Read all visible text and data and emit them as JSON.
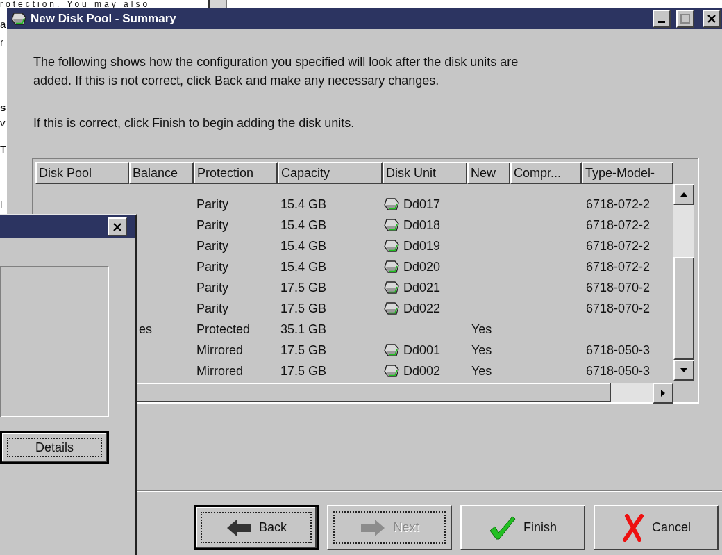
{
  "background_page": {
    "top_line": "rotection. You may also",
    "fragments": [
      {
        "text": "a",
        "bold": false
      },
      {
        "text": "r",
        "bold": false
      },
      {
        "text": "s",
        "bold": true
      },
      {
        "text": "v",
        "bold": false
      },
      {
        "text": "T",
        "bold": false
      },
      {
        "text": "l",
        "bold": false
      }
    ]
  },
  "window": {
    "title": "New Disk Pool - Summary"
  },
  "intro_lines": [
    "The following shows how the configuration you specified will look after the disk units are",
    "added.  If this is not correct, click Back and make any necessary changes."
  ],
  "instruction": "If this is correct, click Finish to begin adding the disk units.",
  "table": {
    "columns": [
      "Disk Pool",
      "Balance",
      "Protection",
      "Capacity",
      "Disk Unit",
      "New",
      "Compr...",
      "Type-Model-"
    ],
    "rows": [
      {
        "protection": "Parity",
        "capacity": "15.4 GB",
        "disk_unit": "Dd017",
        "type_model": "6718-072-2"
      },
      {
        "protection": "Parity",
        "capacity": "15.4 GB",
        "disk_unit": "Dd018",
        "type_model": "6718-072-2"
      },
      {
        "protection": "Parity",
        "capacity": "15.4 GB",
        "disk_unit": "Dd019",
        "type_model": "6718-072-2"
      },
      {
        "protection": "Parity",
        "capacity": "15.4 GB",
        "disk_unit": "Dd020",
        "type_model": "6718-072-2"
      },
      {
        "protection": "Parity",
        "capacity": "17.5 GB",
        "disk_unit": "Dd021",
        "type_model": "6718-070-2"
      },
      {
        "protection": "Parity",
        "capacity": "17.5 GB",
        "disk_unit": "Dd022",
        "type_model": "6718-070-2"
      },
      {
        "balance": "es",
        "protection": "Protected",
        "capacity": "35.1 GB",
        "new": "Yes"
      },
      {
        "protection": "Mirrored",
        "capacity": "17.5 GB",
        "disk_unit": "Dd001",
        "new": "Yes",
        "type_model": "6718-050-3"
      },
      {
        "protection": "Mirrored",
        "capacity": "17.5 GB",
        "disk_unit": "Dd002",
        "new": "Yes",
        "type_model": "6718-050-3"
      }
    ]
  },
  "buttons": [
    {
      "label": "Back",
      "kind": "back",
      "disabled": false,
      "default": true,
      "focus": true
    },
    {
      "label": "Next",
      "kind": "next",
      "disabled": true,
      "default": false,
      "focus": true
    },
    {
      "label": "Finish",
      "kind": "finish",
      "disabled": false,
      "default": false,
      "focus": false
    },
    {
      "label": "Cancel",
      "kind": "cancel",
      "disabled": false,
      "default": false,
      "focus": false
    }
  ],
  "dialog": {
    "button": {
      "label": "Details",
      "default": true,
      "focus": true
    }
  }
}
